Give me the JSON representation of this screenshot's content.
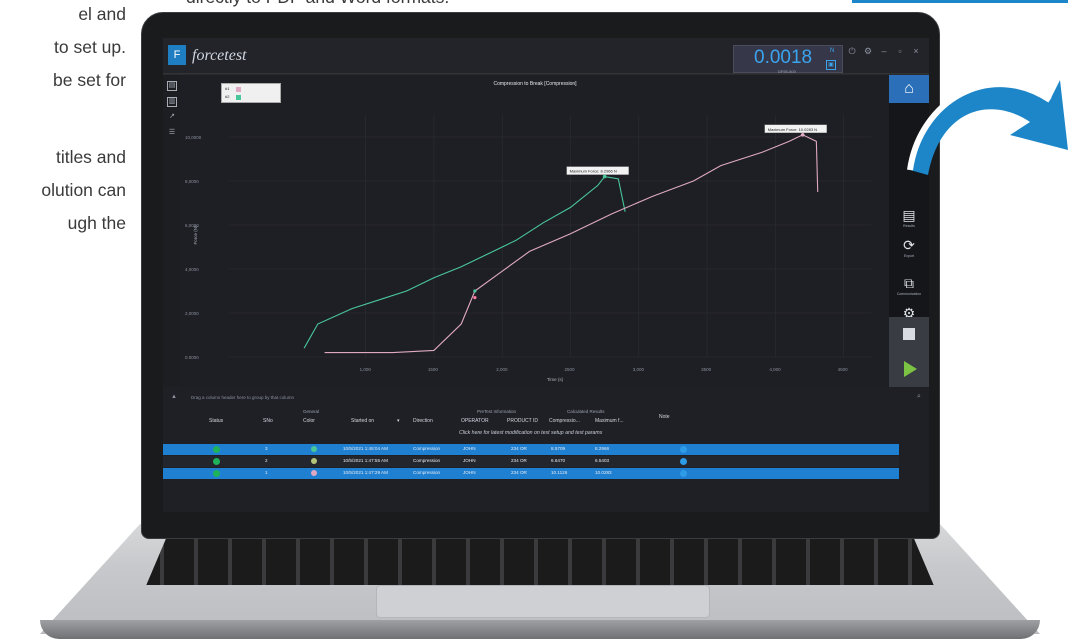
{
  "marketing": {
    "top_line": "directly to PDF and Word formats.",
    "side_lines": [
      "el and",
      "to set up.",
      "be set for",
      "",
      "titles and",
      "olution can",
      "ugh the"
    ]
  },
  "app": {
    "logo_text": "forcetest",
    "load_value": "0.0018",
    "load_unit": "N",
    "load_sub": "DF55-500"
  },
  "chart_data": {
    "type": "line",
    "title": "Compression to Break [Compression]",
    "xlabel": "Time (s)",
    "ylabel": "Force (N)",
    "xlim": [
      0,
      4700
    ],
    "ylim": [
      0,
      11000
    ],
    "x_ticks": [
      "1,000",
      "1500",
      "2,000",
      "2500",
      "3,000",
      "3500",
      "4,000",
      "4500"
    ],
    "y_ticks": [
      "0.0000",
      "2,0000",
      "4,0000",
      "6,0000",
      "8,0000",
      "10,0000"
    ],
    "grid": true,
    "legend": {
      "position": "top-left",
      "entries": [
        "#1",
        "#2"
      ]
    },
    "annotations": [
      {
        "text": "Maximum Force: 8.2966 N",
        "series": 0
      },
      {
        "text": "Maximum Force: 10.0283 N",
        "series": 1
      }
    ],
    "series": [
      {
        "color": "#49c79b",
        "x": [
          550,
          650,
          900,
          1100,
          1300,
          1500,
          1700,
          1900,
          2100,
          2300,
          2500,
          2700,
          2750,
          2850,
          2900
        ],
        "y": [
          400,
          1500,
          2200,
          2600,
          3000,
          3600,
          4100,
          4700,
          5300,
          6100,
          6800,
          7800,
          8200,
          8100,
          6600
        ]
      },
      {
        "color": "#e0a9c3",
        "x": [
          700,
          900,
          1200,
          1500,
          1700,
          1800,
          2000,
          2200,
          2500,
          2800,
          3100,
          3400,
          3600,
          3900,
          4100,
          4200,
          4300,
          4310
        ],
        "y": [
          200,
          200,
          200,
          300,
          1500,
          3000,
          3900,
          4800,
          5600,
          6500,
          7300,
          8000,
          8700,
          9300,
          9800,
          10100,
          9800,
          7500
        ]
      }
    ]
  },
  "nav": {
    "items": [
      {
        "label": "Results",
        "icon": "results-icon"
      },
      {
        "label": "Export",
        "icon": "export-icon"
      },
      {
        "label": "Communication",
        "icon": "communication-icon"
      },
      {
        "label": "Preferences",
        "icon": "gear-icon"
      }
    ]
  },
  "grid": {
    "group_hint": "Drag a column header here to group by that column",
    "band_general": "General",
    "band_pretest": "PreTest Information",
    "band_calc": "Calculated Results",
    "headers": {
      "status": "Status",
      "sno": "SNo",
      "color": "Color",
      "started": "Started on",
      "direction": "Direction",
      "operator": "OPERATOR",
      "product": "PRODUCT ID",
      "compression": "Compressio...",
      "maximum": "Maximum f...",
      "note": "Note"
    },
    "info_text": "Click here for latest modification on test setup and test params",
    "rows": [
      {
        "sno": "3",
        "color": "#49c79b",
        "started": "10/5/2021 1:48:04 AM",
        "direction": "Compression",
        "operator": "JOHN",
        "product": "234 OR",
        "compression": "8.5709",
        "maximum": "8.2966",
        "selected": true
      },
      {
        "sno": "2",
        "color": "#b3c47a",
        "started": "10/5/2021 1:47:55 AM",
        "direction": "Compression",
        "operator": "JOHN",
        "product": "234 OR",
        "compression": "6.6470",
        "maximum": "6.5403",
        "selected": false
      },
      {
        "sno": "1",
        "color": "#e0a9c3",
        "started": "10/5/2021 1:47:29 AM",
        "direction": "Compression",
        "operator": "JOHN",
        "product": "234 OR",
        "compression": "10.1126",
        "maximum": "10.0283",
        "selected": true
      }
    ]
  }
}
